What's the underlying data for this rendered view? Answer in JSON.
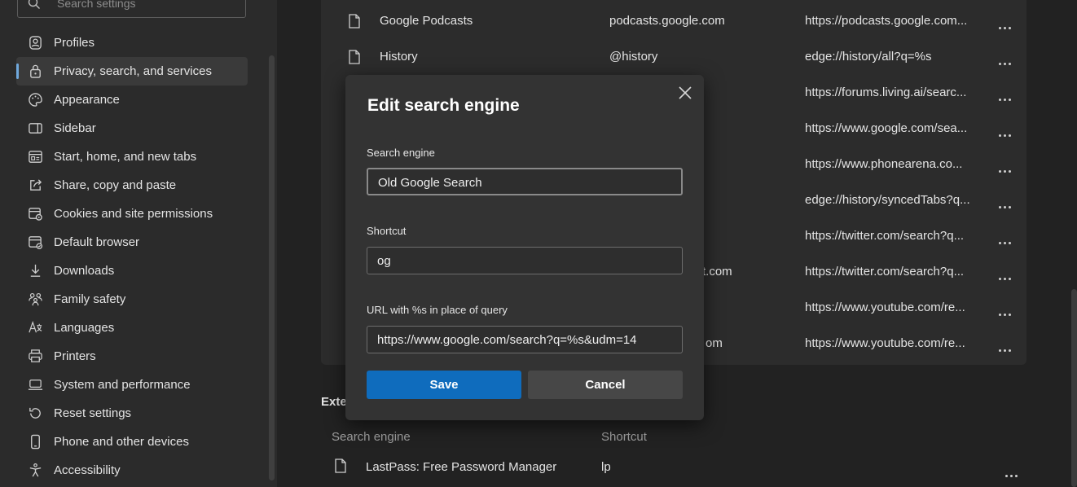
{
  "search": {
    "placeholder": "Search settings"
  },
  "sidebar": {
    "items": [
      {
        "label": "Profiles",
        "icon": "profile-icon"
      },
      {
        "label": "Privacy, search, and services",
        "icon": "lock-icon",
        "active": true
      },
      {
        "label": "Appearance",
        "icon": "palette-icon"
      },
      {
        "label": "Sidebar",
        "icon": "sidebar-icon"
      },
      {
        "label": "Start, home, and new tabs",
        "icon": "home-tabs-icon"
      },
      {
        "label": "Share, copy and paste",
        "icon": "share-icon"
      },
      {
        "label": "Cookies and site permissions",
        "icon": "cookies-icon"
      },
      {
        "label": "Default browser",
        "icon": "browser-icon"
      },
      {
        "label": "Downloads",
        "icon": "download-icon"
      },
      {
        "label": "Family safety",
        "icon": "family-icon"
      },
      {
        "label": "Languages",
        "icon": "languages-icon"
      },
      {
        "label": "Printers",
        "icon": "printer-icon"
      },
      {
        "label": "System and performance",
        "icon": "laptop-icon"
      },
      {
        "label": "Reset settings",
        "icon": "reset-icon"
      },
      {
        "label": "Phone and other devices",
        "icon": "phone-icon"
      },
      {
        "label": "Accessibility",
        "icon": "accessibility-icon"
      }
    ]
  },
  "engines": {
    "rows": [
      {
        "name": "Google Podcasts",
        "keyword": "podcasts.google.com",
        "url": "https://podcasts.google.com..."
      },
      {
        "name": "History",
        "keyword": "@history",
        "url": "edge://history/all?q=%s"
      },
      {
        "name": "",
        "keyword": "",
        "url": "https://forums.living.ai/searc..."
      },
      {
        "name": "",
        "keyword": "",
        "url": "https://www.google.com/sea..."
      },
      {
        "name": "",
        "keyword": "",
        "url": "https://www.phonearena.co..."
      },
      {
        "name": "",
        "keyword": "",
        "url": "edge://history/syncedTabs?q..."
      },
      {
        "name": "",
        "keyword": "",
        "url": "https://twitter.com/search?q..."
      },
      {
        "name": "",
        "keyword": "t.com",
        "url": "https://twitter.com/search?q..."
      },
      {
        "name": "",
        "keyword": "",
        "url": "https://www.youtube.com/re..."
      },
      {
        "name": "",
        "keyword": "om",
        "url": "https://www.youtube.com/re..."
      }
    ]
  },
  "extensions": {
    "title": "Exte",
    "col_search_engine": "Search engine",
    "col_shortcut": "Shortcut",
    "row": {
      "name": "LastPass: Free Password Manager",
      "keyword": "lp"
    }
  },
  "dialog": {
    "title": "Edit search engine",
    "engine_label": "Search engine",
    "engine_value": "Old Google Search",
    "shortcut_label": "Shortcut",
    "shortcut_value": "og",
    "url_label": "URL with %s in place of query",
    "url_value": "https://www.google.com/search?q=%s&udm=14",
    "save_label": "Save",
    "cancel_label": "Cancel"
  },
  "colors": {
    "accent": "#0f6cbd",
    "active_indicator": "#6fa8dc"
  }
}
